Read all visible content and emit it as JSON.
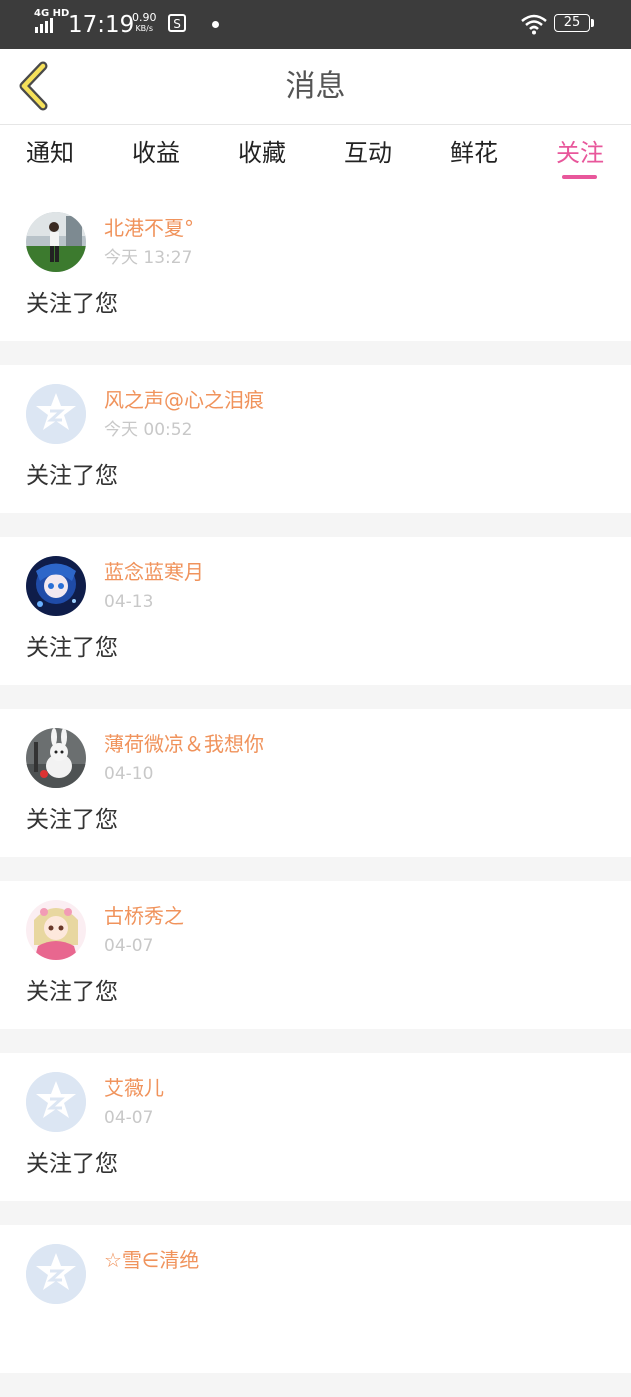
{
  "status_bar": {
    "network": "4G HD",
    "time": "17:19",
    "speed_value": "0.90",
    "speed_unit": "KB/s",
    "battery": "25"
  },
  "header": {
    "title": "消息"
  },
  "tabs": [
    {
      "label": "通知",
      "active": false
    },
    {
      "label": "收益",
      "active": false
    },
    {
      "label": "收藏",
      "active": false
    },
    {
      "label": "互动",
      "active": false
    },
    {
      "label": "鲜花",
      "active": false
    },
    {
      "label": "关注",
      "active": true
    }
  ],
  "colors": {
    "accent": "#e8579b",
    "username": "#f0935c",
    "timestamp": "#c8c8c8"
  },
  "notifications": [
    {
      "name": "北港不夏°",
      "time": "今天 13:27",
      "message": "关注了您",
      "avatar": "photo-avatar"
    },
    {
      "name": "风之声@心之泪痕",
      "time": "今天 00:52",
      "message": "关注了您",
      "avatar": "default-avatar"
    },
    {
      "name": "蓝念蓝寒月",
      "time": "04-13",
      "message": "关注了您",
      "avatar": "anime-avatar"
    },
    {
      "name": "薄荷微凉＆我想你",
      "time": "04-10",
      "message": "关注了您",
      "avatar": "rabbit-avatar"
    },
    {
      "name": "古桥秀之",
      "time": "04-07",
      "message": "关注了您",
      "avatar": "anime-avatar"
    },
    {
      "name": "艾薇儿",
      "time": "04-07",
      "message": "关注了您",
      "avatar": "default-avatar"
    },
    {
      "name": "☆雪∈清绝",
      "time": "",
      "message": "",
      "avatar": "default-avatar"
    }
  ]
}
